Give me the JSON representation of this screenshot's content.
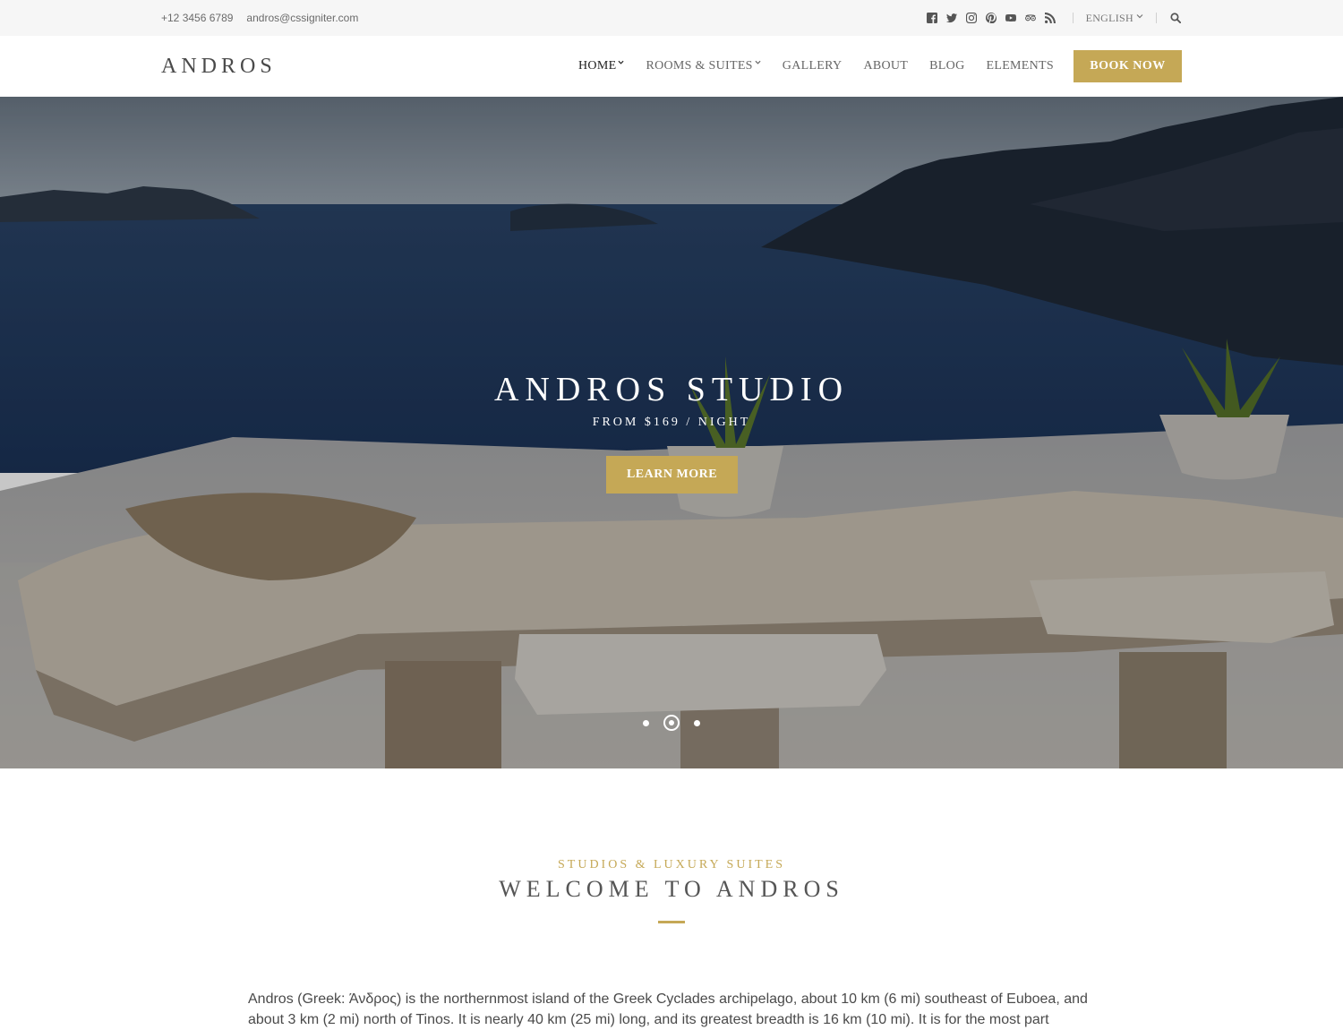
{
  "topbar": {
    "phone": "+12 3456 6789",
    "email": "andros@cssigniter.com",
    "social_icons": [
      "facebook-icon",
      "twitter-icon",
      "instagram-icon",
      "pinterest-icon",
      "youtube-icon",
      "tripadvisor-icon",
      "rss-icon"
    ],
    "language": "ENGLISH"
  },
  "header": {
    "logo": "ANDROS",
    "nav": {
      "home": "HOME",
      "rooms": "ROOMS & SUITES",
      "gallery": "GALLERY",
      "about": "ABOUT",
      "blog": "BLOG",
      "elements": "ELEMENTS"
    },
    "book_label": "BOOK NOW"
  },
  "hero": {
    "title": "ANDROS STUDIO",
    "subtitle": "FROM $169 / NIGHT",
    "button": "LEARN MORE",
    "slides": 3,
    "active_slide": 2
  },
  "welcome": {
    "eyebrow": "STUDIOS & LUXURY SUITES",
    "title": "WELCOME TO ANDROS",
    "intro": "Andros (Greek: Άνδρος) is the northernmost island of the Greek Cyclades archipelago, about 10 km (6 mi) southeast of Euboea, and about 3 km (2 mi) north of Tinos. It is nearly 40 km (25 mi) long, and its greatest breadth is 16 km (10 mi). It is for the most part"
  },
  "colors": {
    "accent": "#c5a856",
    "topbar_bg": "#f6f6f6",
    "text": "#4a4a4a"
  }
}
